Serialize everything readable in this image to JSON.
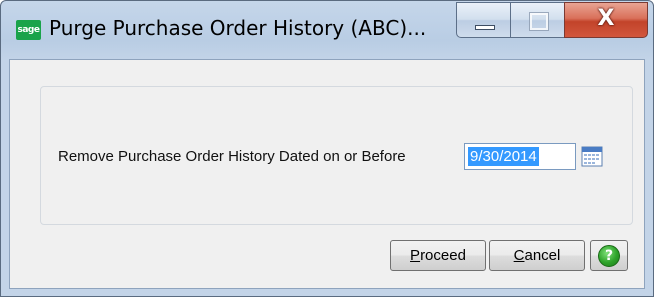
{
  "window": {
    "app_icon_text": "sage",
    "title": "Purge Purchase Order History (ABC)...",
    "close_glyph": "X"
  },
  "form": {
    "label": "Remove Purchase Order History Dated on or Before",
    "date_value": "9/30/2014"
  },
  "buttons": {
    "proceed_accel": "P",
    "proceed_rest": "roceed",
    "cancel_accel": "C",
    "cancel_rest": "ancel",
    "help_glyph": "?"
  },
  "colors": {
    "accent_selection": "#3399ff",
    "sage_green": "#1aa34a",
    "close_red": "#c2432a"
  },
  "icons": [
    "sage-logo-icon",
    "minimize-icon",
    "maximize-icon",
    "close-icon",
    "calendar-icon",
    "help-icon"
  ]
}
